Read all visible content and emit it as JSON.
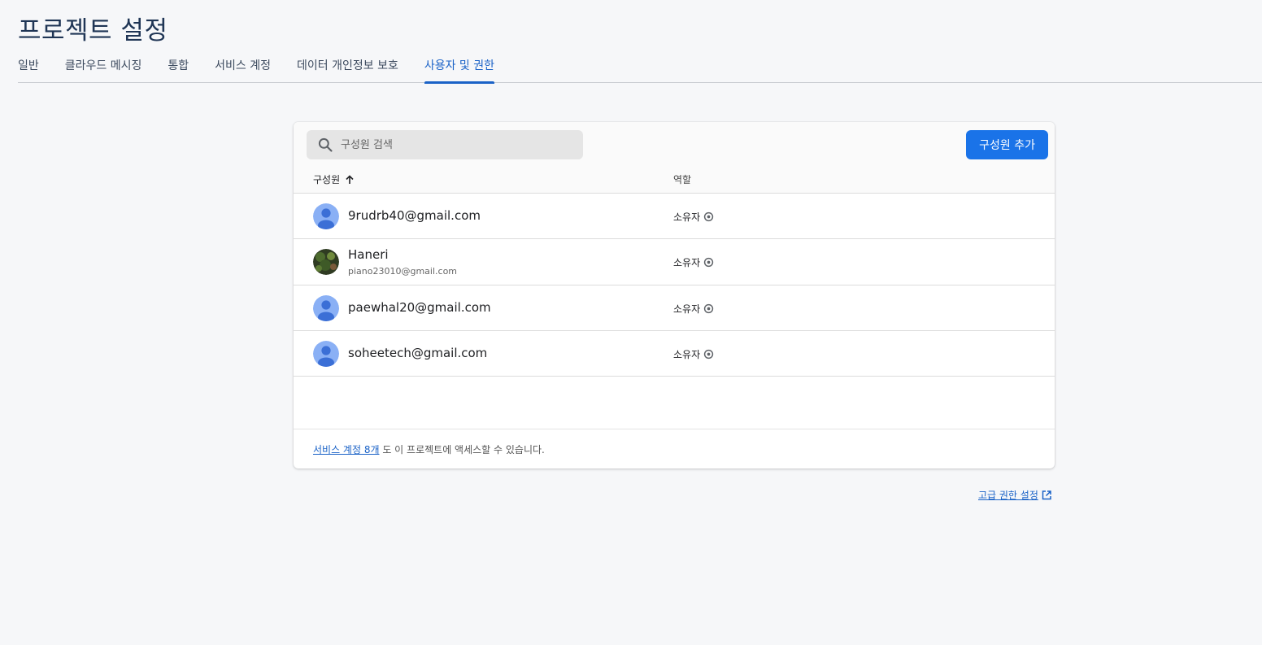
{
  "page": {
    "title": "프로젝트 설정"
  },
  "tabs": [
    {
      "label": "일반",
      "active": false
    },
    {
      "label": "클라우드 메시징",
      "active": false
    },
    {
      "label": "통합",
      "active": false
    },
    {
      "label": "서비스 계정",
      "active": false
    },
    {
      "label": "데이터 개인정보 보호",
      "active": false
    },
    {
      "label": "사용자 및 권한",
      "active": true
    }
  ],
  "search": {
    "placeholder": "구성원 검색",
    "value": "",
    "icon": "search-icon"
  },
  "toolbar": {
    "add_label": "구성원 추가"
  },
  "columns": {
    "member": "구성원",
    "member_sort": "ascending",
    "role": "역할"
  },
  "members": [
    {
      "primary": "9rudrb40@gmail.com",
      "secondary": "",
      "role": "소유자",
      "avatar": "default"
    },
    {
      "primary": "Haneri",
      "secondary": "piano23010@gmail.com",
      "role": "소유자",
      "avatar": "photo"
    },
    {
      "primary": "paewhal20@gmail.com",
      "secondary": "",
      "role": "소유자",
      "avatar": "default"
    },
    {
      "primary": "soheetech@gmail.com",
      "secondary": "",
      "role": "소유자",
      "avatar": "default"
    }
  ],
  "footer": {
    "link": "서비스 계정 8개",
    "text": " 도 이 프로젝트에 액세스할 수 있습니다."
  },
  "advanced_link": "고급 권한 설정",
  "colors": {
    "accent": "#1a73e8",
    "link": "#1a62c7",
    "title": "#1f3555",
    "avatar": "#8ab0f5"
  }
}
